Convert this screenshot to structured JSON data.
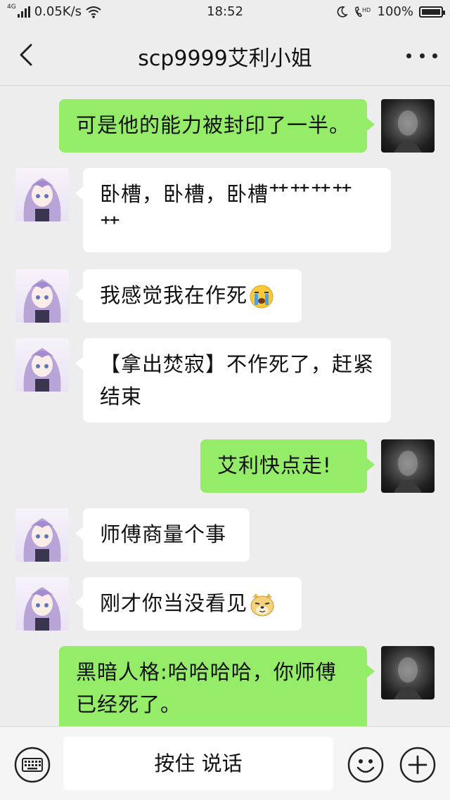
{
  "status_bar": {
    "network_type": "4G",
    "speed": "0.05K/s",
    "time": "18:52",
    "hd_label": "HD",
    "battery": "100%"
  },
  "nav": {
    "title": "scp9999艾利小姐"
  },
  "messages": [
    {
      "side": "me",
      "text": "可是他的能力被封印了一半。"
    },
    {
      "side": "them",
      "lines": [
        "卧槽，卧槽，卧槽⺿⺿⺿⺿",
        "⺿"
      ]
    },
    {
      "side": "them",
      "text": "我感觉我在作死",
      "emoji": "crying-face"
    },
    {
      "side": "them",
      "lines": [
        "【拿出焚寂】不作死了，赶紧",
        "结束"
      ]
    },
    {
      "side": "me",
      "text": "艾利快点走!"
    },
    {
      "side": "them",
      "text": "师傅商量个事"
    },
    {
      "side": "them",
      "text": "刚才你当没看见",
      "emoji": "doge-face"
    },
    {
      "side": "me",
      "lines": [
        "黑暗人格:哈哈哈哈，你师傅",
        "已经死了。"
      ]
    }
  ],
  "input_bar": {
    "voice_label": "按住 说话"
  },
  "colors": {
    "background": "#ededed",
    "my_bubble": "#95ec69",
    "their_bubble": "#ffffff"
  }
}
